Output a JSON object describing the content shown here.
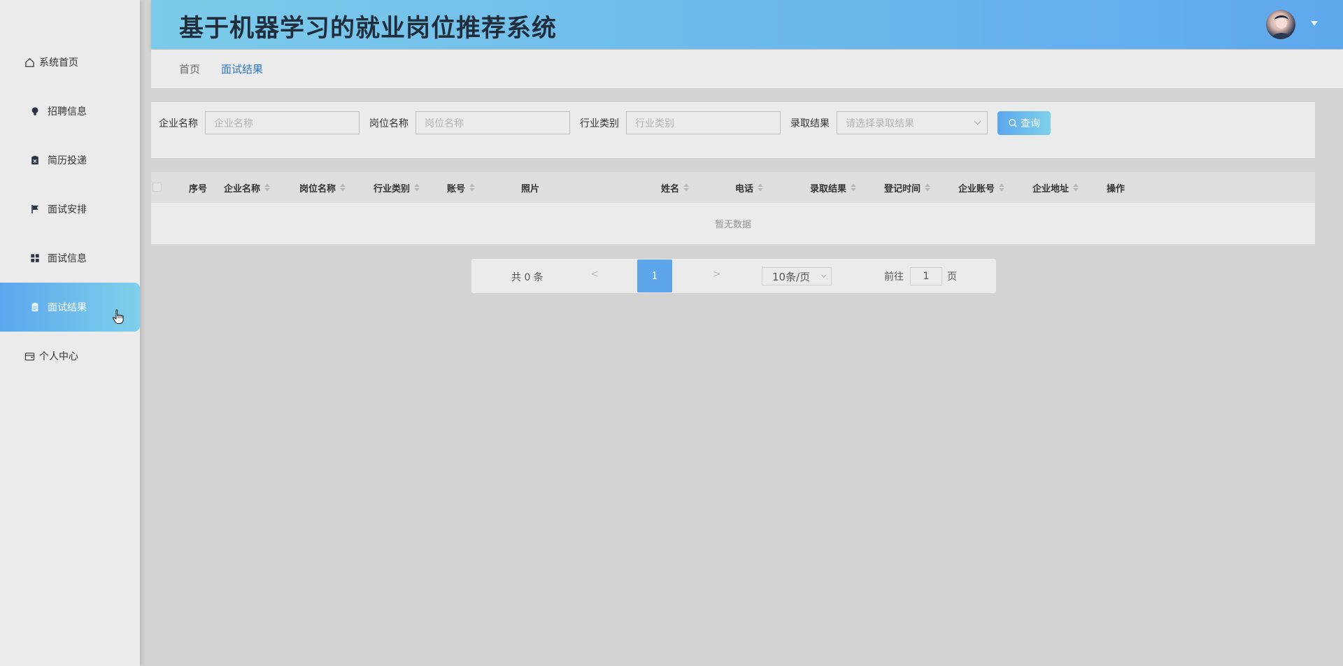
{
  "app": {
    "title": "基于机器学习的就业岗位推荐系统"
  },
  "sidebar": {
    "items": [
      {
        "label": "系统首页",
        "icon": "home-icon"
      },
      {
        "label": "招聘信息",
        "icon": "lightbulb-icon"
      },
      {
        "label": "简历投递",
        "icon": "clipboard-x-icon"
      },
      {
        "label": "面试安排",
        "icon": "flag-icon"
      },
      {
        "label": "面试信息",
        "icon": "grid-icon"
      },
      {
        "label": "面试结果",
        "icon": "document-icon",
        "active": true
      },
      {
        "label": "个人中心",
        "icon": "wallet-icon"
      }
    ]
  },
  "breadcrumb": {
    "home": "首页",
    "current": "面试结果"
  },
  "search": {
    "company_label": "企业名称",
    "company_placeholder": "企业名称",
    "position_label": "岗位名称",
    "position_placeholder": "岗位名称",
    "industry_label": "行业类别",
    "industry_placeholder": "行业类别",
    "result_label": "录取结果",
    "result_placeholder": "请选择录取结果",
    "query_button": "查询"
  },
  "table": {
    "columns": [
      "序号",
      "企业名称",
      "岗位名称",
      "行业类别",
      "账号",
      "照片",
      "姓名",
      "电话",
      "录取结果",
      "登记时间",
      "企业账号",
      "企业地址",
      "操作"
    ],
    "empty_text": "暂无数据"
  },
  "pagination": {
    "total": "共 0 条",
    "prev": "<",
    "current_page": "1",
    "next": ">",
    "page_size": "10条/页",
    "goto_label": "前往",
    "goto_value": "1",
    "goto_unit": "页"
  },
  "colors": {
    "accent_start": "#5ca6ee",
    "accent_end": "#7fd0ea",
    "link": "#2e78c4"
  }
}
